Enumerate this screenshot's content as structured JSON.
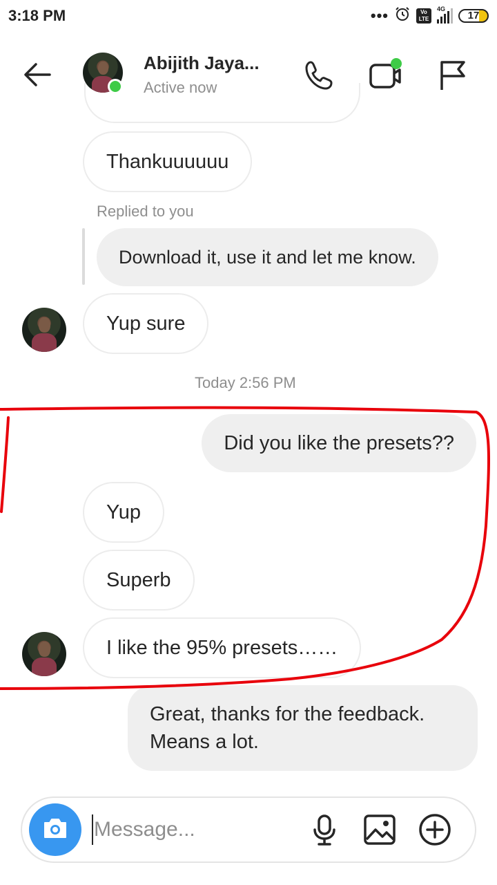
{
  "status_bar": {
    "time": "3:18 PM",
    "dots": "•••",
    "network_label": "4G",
    "volte_label": "Vo LTE",
    "battery": "17"
  },
  "header": {
    "contact_name": "Abijith Jaya...",
    "status": "Active now",
    "icons": [
      "back-arrow-icon",
      "phone-icon",
      "video-icon",
      "flag-icon"
    ]
  },
  "messages": {
    "m1": "Thankuuuuuu",
    "reply_label": "Replied to you",
    "replied_text": "Download it, use it and let me know.",
    "m2": "Yup sure",
    "timestamp": "Today 2:56 PM",
    "m3": "Did you like the presets??",
    "m4": "Yup",
    "m5": "Superb",
    "m6": "I like the 95% presets……",
    "m7": "Great, thanks for the feedback. Means a lot."
  },
  "composer": {
    "placeholder": "Message..."
  },
  "colors": {
    "accent": "#3897f0",
    "online": "#3ecb47",
    "annotation": "#e8000b",
    "outgoing_bubble": "#efefef"
  }
}
